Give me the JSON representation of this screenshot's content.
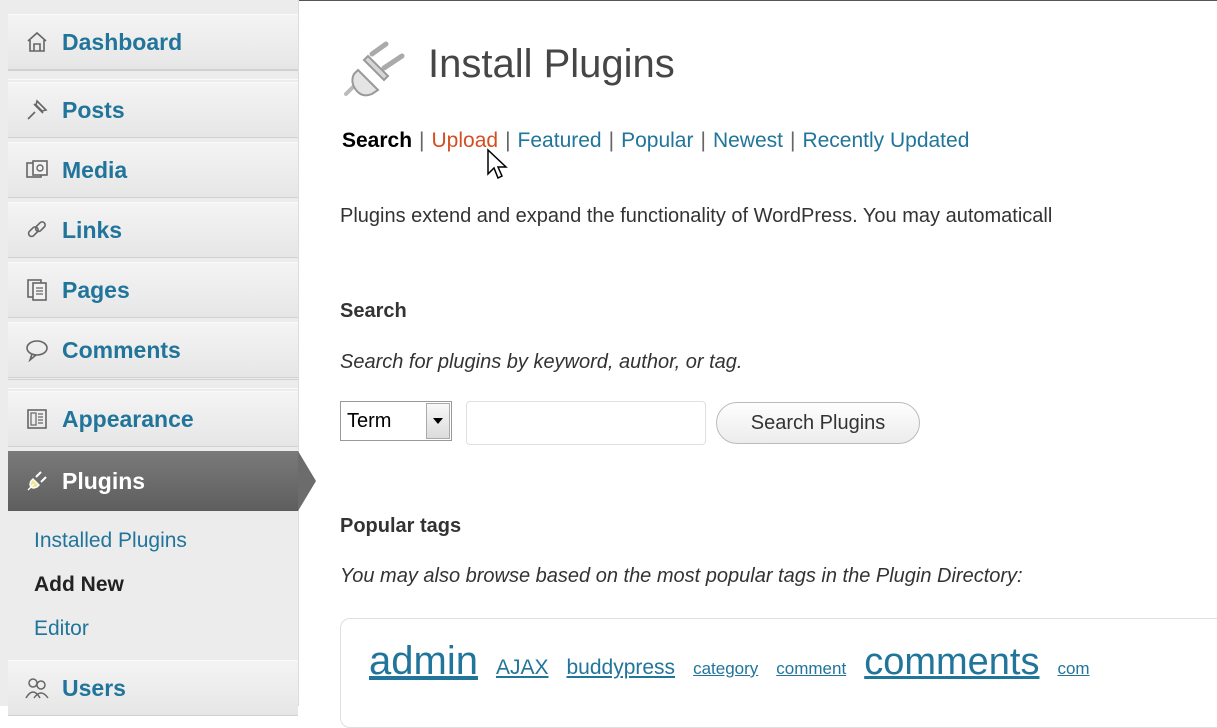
{
  "sidebar": {
    "items": [
      {
        "label": "Dashboard",
        "icon": "dashboard-icon"
      },
      {
        "label": "Posts",
        "icon": "pushpin-icon"
      },
      {
        "label": "Media",
        "icon": "media-icon"
      },
      {
        "label": "Links",
        "icon": "link-icon"
      },
      {
        "label": "Pages",
        "icon": "pages-icon"
      },
      {
        "label": "Comments",
        "icon": "comment-bubble-icon"
      },
      {
        "label": "Appearance",
        "icon": "appearance-icon"
      },
      {
        "label": "Plugins",
        "icon": "plug-icon",
        "active": true
      },
      {
        "label": "Users",
        "icon": "users-icon"
      }
    ],
    "submenu": [
      {
        "label": "Installed Plugins"
      },
      {
        "label": "Add New",
        "current": true
      },
      {
        "label": "Editor"
      }
    ]
  },
  "main": {
    "title": "Install Plugins",
    "tabs": [
      {
        "label": "Search",
        "current": true
      },
      {
        "label": "Upload",
        "hover": true
      },
      {
        "label": "Featured"
      },
      {
        "label": "Popular"
      },
      {
        "label": "Newest"
      },
      {
        "label": "Recently Updated"
      }
    ],
    "tab_separator": "|",
    "intro": "Plugins extend and expand the functionality of WordPress. You may automaticall",
    "search": {
      "heading": "Search",
      "description": "Search for plugins by keyword, author, or tag.",
      "select_value": "Term",
      "input_value": "",
      "button_label": "Search Plugins"
    },
    "popular_tags": {
      "heading": "Popular tags",
      "description": "You may also browse based on the most popular tags in the Plugin Directory:",
      "tags": [
        {
          "label": "admin"
        },
        {
          "label": "AJAX"
        },
        {
          "label": "buddypress"
        },
        {
          "label": "category"
        },
        {
          "label": "comment"
        },
        {
          "label": "comments"
        },
        {
          "label": "com"
        }
      ]
    }
  },
  "colors": {
    "link": "#21759b",
    "hover_link": "#d54e21",
    "active_menu": "#6c6c6c"
  }
}
